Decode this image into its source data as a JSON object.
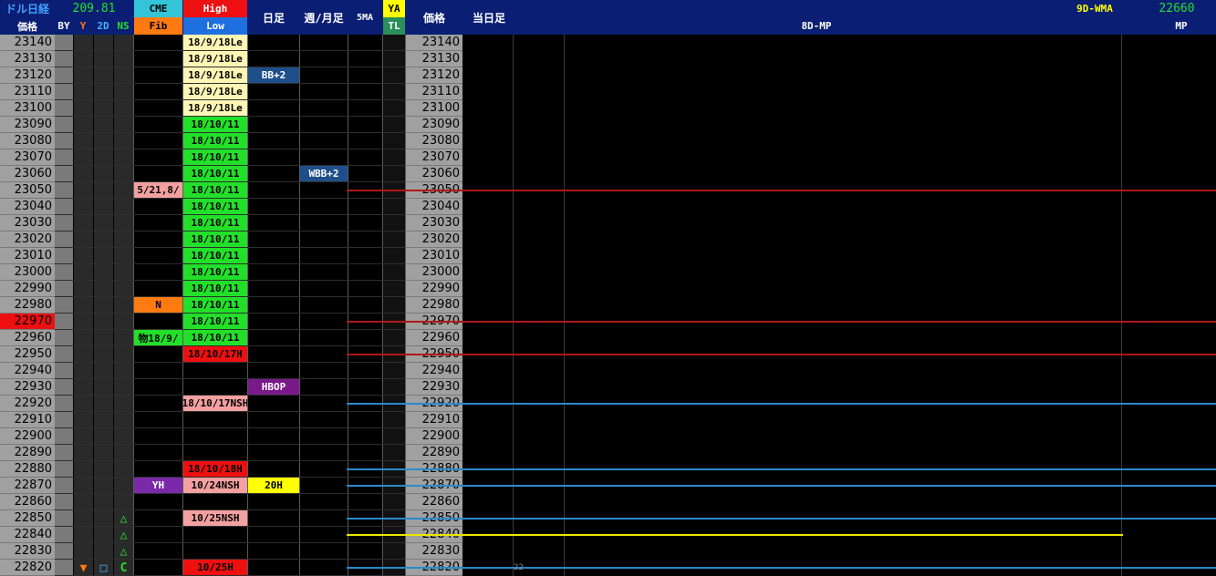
{
  "header": {
    "title": "ドル日経",
    "value": "209.81",
    "price_label": "価格",
    "sub_cols": [
      "BY",
      "Y",
      "2D",
      "NS"
    ],
    "cme": "CME",
    "fib": "Fib",
    "high": "High",
    "low": "Low",
    "daily": "日足",
    "weekly_monthly": "週/月足",
    "ma5": "5MA",
    "ya": "YA",
    "tl": "TL",
    "price2": "価格",
    "today": "当日足",
    "mp8d": "8D-MP",
    "wma9d": "9D-WMA",
    "mp_value": "22660",
    "mp": "MP"
  },
  "prices": [
    "23140",
    "23130",
    "23120",
    "23110",
    "23100",
    "23090",
    "23080",
    "23070",
    "23060",
    "23050",
    "23040",
    "23030",
    "23020",
    "23010",
    "23000",
    "22990",
    "22980",
    "22970",
    "22960",
    "22950",
    "22940",
    "22930",
    "22920",
    "22910",
    "22900",
    "22890",
    "22880",
    "22870",
    "22860",
    "22850",
    "22840",
    "22830",
    "22820"
  ],
  "current_price": "22970",
  "highlow_cells": [
    {
      "row": 0,
      "text": "18/9/18Le",
      "bg": "#fff5b4",
      "fg": "#000"
    },
    {
      "row": 1,
      "text": "18/9/18Le",
      "bg": "#fff5b4",
      "fg": "#000"
    },
    {
      "row": 2,
      "text": "18/9/18Le",
      "bg": "#fff5b4",
      "fg": "#000"
    },
    {
      "row": 3,
      "text": "18/9/18Le",
      "bg": "#fff5b4",
      "fg": "#000"
    },
    {
      "row": 4,
      "text": "18/9/18Le",
      "bg": "#fff5b4",
      "fg": "#000"
    },
    {
      "row": 5,
      "text": "18/10/11",
      "bg": "#22e02a",
      "fg": "#000"
    },
    {
      "row": 6,
      "text": "18/10/11",
      "bg": "#22e02a",
      "fg": "#000"
    },
    {
      "row": 7,
      "text": "18/10/11",
      "bg": "#22e02a",
      "fg": "#000"
    },
    {
      "row": 8,
      "text": "18/10/11",
      "bg": "#22e02a",
      "fg": "#000"
    },
    {
      "row": 9,
      "text": "18/10/11",
      "bg": "#22e02a",
      "fg": "#000"
    },
    {
      "row": 10,
      "text": "18/10/11",
      "bg": "#22e02a",
      "fg": "#000"
    },
    {
      "row": 11,
      "text": "18/10/11",
      "bg": "#22e02a",
      "fg": "#000"
    },
    {
      "row": 12,
      "text": "18/10/11",
      "bg": "#22e02a",
      "fg": "#000"
    },
    {
      "row": 13,
      "text": "18/10/11",
      "bg": "#22e02a",
      "fg": "#000"
    },
    {
      "row": 14,
      "text": "18/10/11",
      "bg": "#22e02a",
      "fg": "#000"
    },
    {
      "row": 15,
      "text": "18/10/11",
      "bg": "#22e02a",
      "fg": "#000"
    },
    {
      "row": 16,
      "text": "18/10/11",
      "bg": "#22e02a",
      "fg": "#000"
    },
    {
      "row": 17,
      "text": "18/10/11",
      "bg": "#22e02a",
      "fg": "#000"
    },
    {
      "row": 18,
      "text": "18/10/11",
      "bg": "#22e02a",
      "fg": "#000"
    },
    {
      "row": 19,
      "text": "18/10/17H",
      "bg": "#ee1010",
      "fg": "#000"
    },
    {
      "row": 22,
      "text": "18/10/17NSH",
      "bg": "#f4a0a0",
      "fg": "#000"
    },
    {
      "row": 26,
      "text": "18/10/18H",
      "bg": "#ee1010",
      "fg": "#000"
    },
    {
      "row": 27,
      "text": "10/24NSH",
      "bg": "#f4a0a0",
      "fg": "#000"
    },
    {
      "row": 29,
      "text": "10/25NSH",
      "bg": "#f4a0a0",
      "fg": "#000"
    },
    {
      "row": 32,
      "text": "10/25H",
      "bg": "#ee1010",
      "fg": "#000"
    }
  ],
  "cme_cells": [
    {
      "row": 9,
      "text": "5/21,8/",
      "bg": "#f4a0a0",
      "fg": "#000"
    },
    {
      "row": 16,
      "text": "N",
      "bg": "#ff7a10",
      "fg": "#000"
    },
    {
      "row": 18,
      "text": "物18/9/",
      "bg": "#22e02a",
      "fg": "#000"
    },
    {
      "row": 27,
      "text": "YH",
      "bg": "#7a2aa8",
      "fg": "#fff"
    }
  ],
  "daily_cells": [
    {
      "row": 2,
      "text": "BB+2",
      "bg": "#1e4f8a",
      "fg": "#fff"
    },
    {
      "row": 21,
      "text": "HBOP",
      "bg": "#7a1a8a",
      "fg": "#fff"
    },
    {
      "row": 27,
      "text": "20H",
      "bg": "#ffff00",
      "fg": "#000"
    }
  ],
  "weekly_cells": [
    {
      "row": 8,
      "text": "WBB+2",
      "bg": "#1e4f8a",
      "fg": "#fff"
    }
  ],
  "ns_marks": [
    {
      "row": 29,
      "text": "△",
      "color": "#22e02a"
    },
    {
      "row": 30,
      "text": "△",
      "color": "#22e02a"
    },
    {
      "row": 31,
      "text": "△",
      "color": "#22e02a"
    },
    {
      "row": 32,
      "text": "C",
      "color": "#22e02a"
    }
  ],
  "y_marks": [
    {
      "row": 32,
      "text": "▼",
      "color": "#ff7a10"
    }
  ],
  "d2_marks": [
    {
      "row": 32,
      "text": "□",
      "color": "#4ab0ff"
    }
  ],
  "lines": [
    {
      "row": 9,
      "color": "#b01818"
    },
    {
      "row": 17,
      "color": "#b01818"
    },
    {
      "row": 19,
      "color": "#b01818"
    },
    {
      "row": 22,
      "color": "#2a8acc"
    },
    {
      "row": 26,
      "color": "#2a8acc"
    },
    {
      "row": 27,
      "color": "#2a8acc"
    },
    {
      "row": 29,
      "color": "#2a8acc"
    },
    {
      "row": 32,
      "color": "#2a8acc"
    }
  ],
  "yellow_line_row": 30,
  "chart_small_label": "22"
}
